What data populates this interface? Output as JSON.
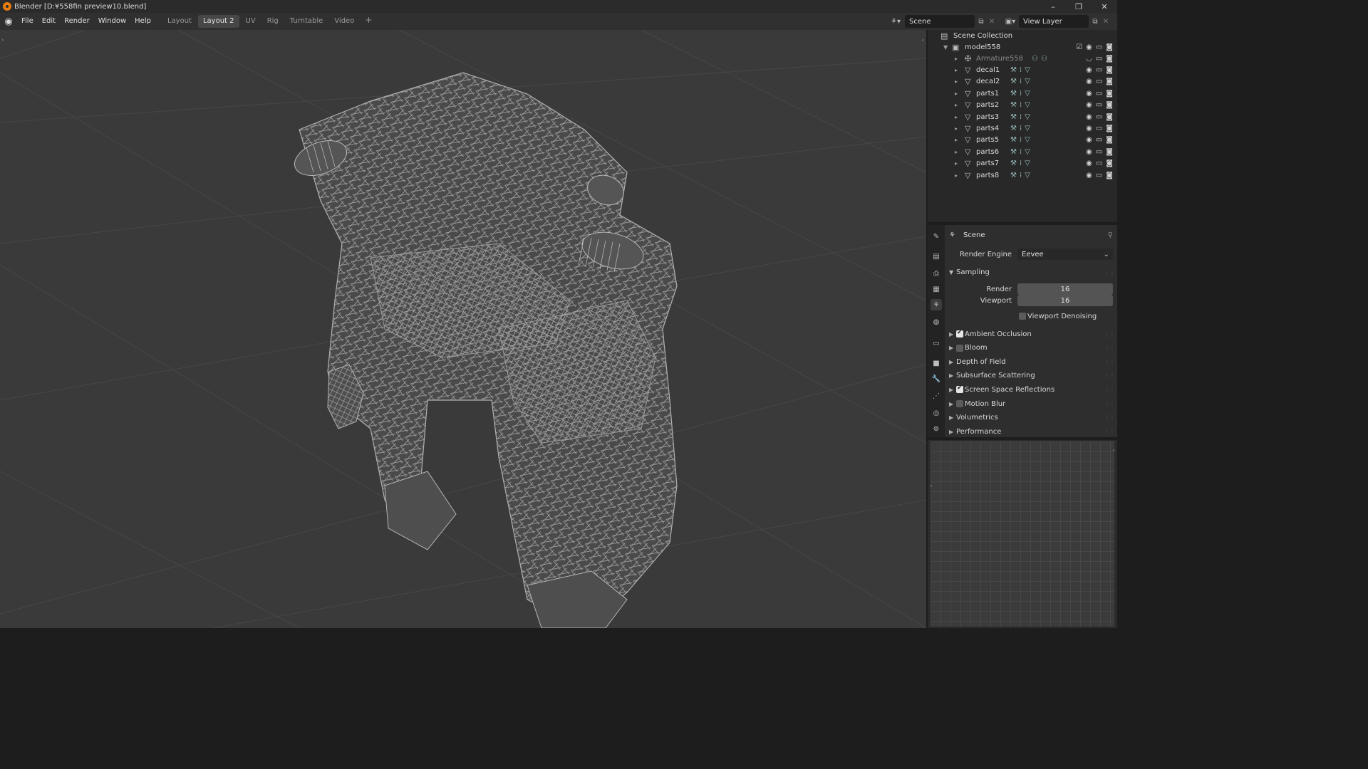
{
  "window": {
    "title": "Blender [D:¥558fin preview10.blend]",
    "controls": [
      "–",
      "❐",
      "✕"
    ]
  },
  "menu": [
    "File",
    "Edit",
    "Render",
    "Window",
    "Help"
  ],
  "workspaces": {
    "tabs": [
      "Layout",
      "Layout 2",
      "UV",
      "Rig",
      "Turntable",
      "Video"
    ],
    "active": "Layout 2",
    "add": "+"
  },
  "scene": {
    "name": "Scene"
  },
  "view_layer": {
    "name": "View Layer"
  },
  "outliner": {
    "root": "Scene Collection",
    "collection": "model558",
    "items": [
      {
        "name": "Armature558",
        "dim": true
      },
      {
        "name": "decal1"
      },
      {
        "name": "decal2"
      },
      {
        "name": "parts1"
      },
      {
        "name": "parts2"
      },
      {
        "name": "parts3"
      },
      {
        "name": "parts4"
      },
      {
        "name": "parts5"
      },
      {
        "name": "parts6"
      },
      {
        "name": "parts7"
      },
      {
        "name": "parts8"
      }
    ]
  },
  "properties": {
    "header": "Scene",
    "render_engine_label": "Render Engine",
    "render_engine_value": "Eevee",
    "sampling": {
      "title": "Sampling",
      "render_label": "Render",
      "render_value": "16",
      "viewport_label": "Viewport",
      "viewport_value": "16",
      "denoise_label": "Viewport Denoising"
    },
    "panels": [
      {
        "label": "Ambient Occlusion",
        "checkbox": true,
        "checked": true
      },
      {
        "label": "Bloom",
        "checkbox": true,
        "checked": false
      },
      {
        "label": "Depth of Field",
        "checkbox": false
      },
      {
        "label": "Subsurface Scattering",
        "checkbox": false
      },
      {
        "label": "Screen Space Reflections",
        "checkbox": true,
        "checked": true
      },
      {
        "label": "Motion Blur",
        "checkbox": true,
        "checked": false
      },
      {
        "label": "Volumetrics",
        "checkbox": false
      },
      {
        "label": "Performance",
        "checkbox": false
      }
    ]
  },
  "colors": {
    "accent": "#e87d0d",
    "wire": "#9a9a9a",
    "viewport_bg": "#3a3a3a"
  }
}
